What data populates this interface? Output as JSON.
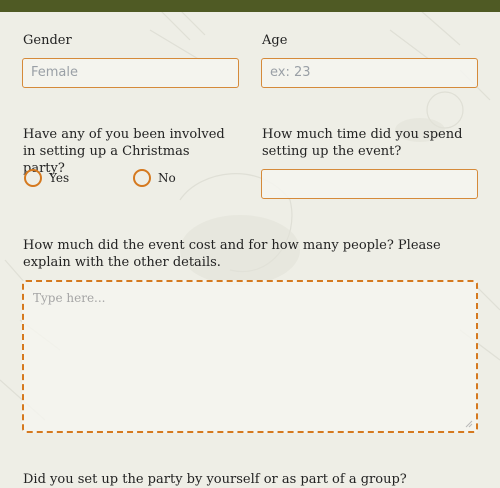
{
  "form": {
    "gender": {
      "label": "Gender",
      "placeholder": "Female"
    },
    "age": {
      "label": "Age",
      "placeholder": "ex: 23"
    },
    "involved": {
      "question": "Have any of you been involved in setting up a Christmas party?",
      "options": [
        "Yes",
        "No"
      ]
    },
    "time": {
      "question": "How much time did you spend setting up the event?",
      "value": ""
    },
    "cost": {
      "question": "How much did the event cost and for how many people? Please explain with the other details.",
      "placeholder": "Type here..."
    },
    "group": {
      "question": "Did you set up the party by yourself or as part of a group?"
    }
  },
  "colors": {
    "accent": "#d5791f",
    "topbar": "#4f5a24",
    "background": "#eeeee6"
  }
}
